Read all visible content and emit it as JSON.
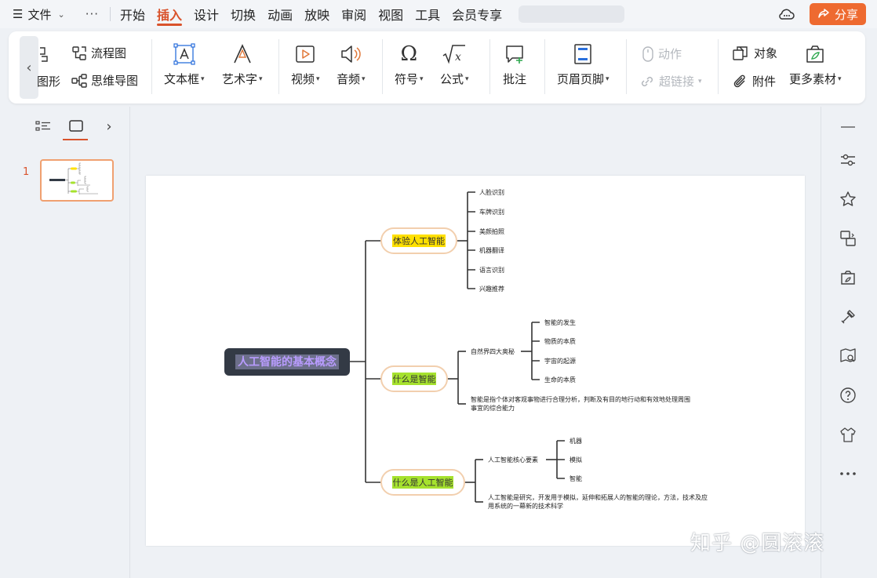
{
  "menu": {
    "file_label": "文件",
    "more_label": "···",
    "tabs": [
      "开始",
      "插入",
      "设计",
      "切换",
      "动画",
      "放映",
      "审阅",
      "视图",
      "工具",
      "会员专享"
    ],
    "active_tab": "插入",
    "share_label": "分享"
  },
  "ribbon": {
    "shape_label": "图形",
    "flowchart_label": "流程图",
    "mindmap_label": "思维导图",
    "textbox_label": "文本框",
    "wordart_label": "艺术字",
    "video_label": "视频",
    "audio_label": "音频",
    "symbol_label": "符号",
    "formula_label": "公式",
    "comment_label": "批注",
    "header_footer_label": "页眉页脚",
    "action_label": "动作",
    "hyperlink_label": "超链接",
    "object_label": "对象",
    "attachment_label": "附件",
    "more_assets_label": "更多素材"
  },
  "slides": {
    "current_number": "1"
  },
  "mindmap": {
    "root": "人工智能的基本概念",
    "branch1": {
      "label": "体验人工智能",
      "children": [
        "人脸识别",
        "车牌识别",
        "美颜拍照",
        "机器翻译",
        "语言识别",
        "兴趣推荐"
      ]
    },
    "branch2": {
      "label": "什么是智能",
      "sub_label": "自然界四大奥秘",
      "sub_children": [
        "智能的发生",
        "物质的本质",
        "宇宙的起源",
        "生命的本质"
      ],
      "definition_line1": "智能是指个体对客观事物进行合理分析，判断及有目的地行动和有效地处理周围",
      "definition_line2": "事宜的综合能力"
    },
    "branch3": {
      "label": "什么是人工智能",
      "sub_label": "人工智能核心要素",
      "sub_children": [
        "机器",
        "模拟",
        "智能"
      ],
      "definition_line1": "人工智能是研究，开发用于模拟，延伸和拓展人的智能的理论，方法，技术及应",
      "definition_line2": "用系统的一幕新的技术科学"
    }
  },
  "watermark": "知乎 @圆滚滚",
  "colors": {
    "accent": "#d9532c",
    "share": "#ee6a30",
    "root_bg": "#333a45",
    "root_text": "#a98cf7",
    "highlight_yellow": "#ffe000",
    "highlight_green": "#a6e22e",
    "branch_border": "#f2cfae"
  }
}
